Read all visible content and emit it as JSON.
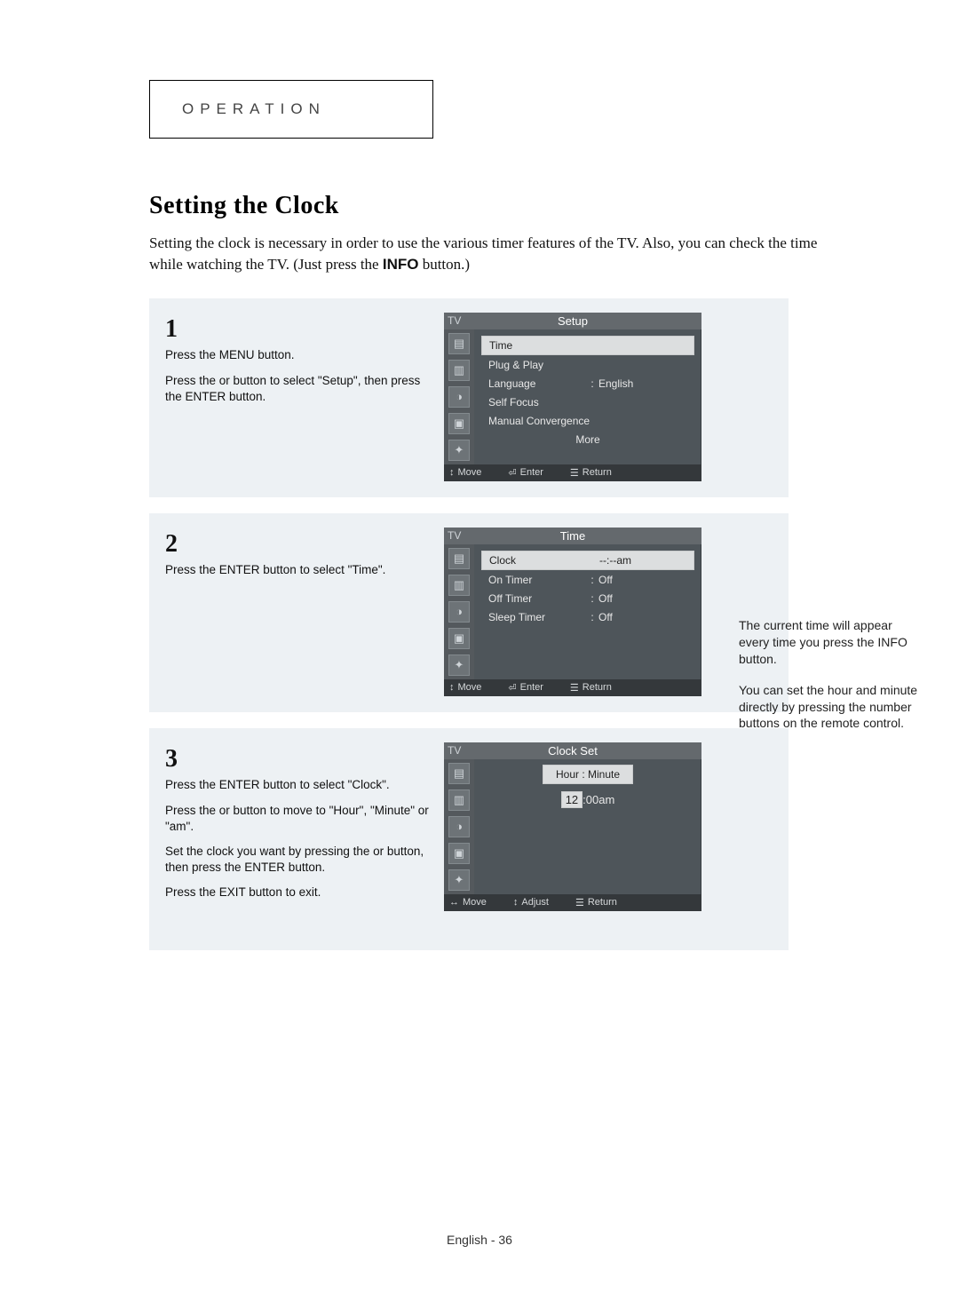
{
  "header": {
    "label": "OPERATION"
  },
  "title": "Setting the Clock",
  "intro": {
    "text_before": "Setting the clock is necessary in order to use the various timer features of the TV. Also, you can check the time while watching the TV. (Just press the ",
    "bold": "INFO",
    "text_after": " button.)"
  },
  "steps": [
    {
      "num": "1",
      "paragraphs": [
        "Press the MENU button.",
        "Press the    or    button to select \"Setup\", then press the ENTER button."
      ],
      "osd": {
        "tv": "TV",
        "title": "Setup",
        "rows": [
          {
            "label": "Time",
            "sep": "",
            "val": "",
            "selected": true
          },
          {
            "label": "Plug & Play",
            "sep": "",
            "val": "",
            "selected": false
          },
          {
            "label": "Language",
            "sep": ":",
            "val": "English",
            "selected": false
          },
          {
            "label": "Self Focus",
            "sep": "",
            "val": "",
            "selected": false
          },
          {
            "label": "Manual Convergence",
            "sep": "",
            "val": "",
            "selected": false
          },
          {
            "label": "More",
            "sep": "",
            "val": "",
            "selected": false,
            "centered": true
          }
        ],
        "footer": {
          "move": "Move",
          "enter": "Enter",
          "return": "Return",
          "move_glyph": "↕",
          "enter_glyph": "⏎",
          "return_glyph": "☰"
        }
      }
    },
    {
      "num": "2",
      "paragraphs": [
        "Press the ENTER button to select \"Time\"."
      ],
      "osd": {
        "tv": "TV",
        "title": "Time",
        "rows": [
          {
            "label": "Clock",
            "sep": "",
            "val": "--:--am",
            "selected": true
          },
          {
            "label": "On Timer",
            "sep": ":",
            "val": "Off",
            "selected": false
          },
          {
            "label": "Off Timer",
            "sep": ":",
            "val": "Off",
            "selected": false
          },
          {
            "label": "Sleep Timer",
            "sep": ":",
            "val": "Off",
            "selected": false
          }
        ],
        "footer": {
          "move": "Move",
          "enter": "Enter",
          "return": "Return",
          "move_glyph": "↕",
          "enter_glyph": "⏎",
          "return_glyph": "☰"
        }
      }
    },
    {
      "num": "3",
      "paragraphs": [
        "Press the ENTER button to select \"Clock\".",
        "Press the    or    button to move to \"Hour\", \"Minute\" or \"am\".",
        "Set the clock you want by pressing the    or    button, then press the ENTER button.",
        "Press the EXIT button to exit."
      ],
      "osd": {
        "tv": "TV",
        "title": "Clock Set",
        "clockset": {
          "hm_label": "Hour : Minute",
          "hour": "12",
          "colon": ":",
          "minute": "00",
          "ampm": "am"
        },
        "footer": {
          "move": "Move",
          "enter": "Adjust",
          "return": "Return",
          "move_glyph": "↔",
          "enter_glyph": "↕",
          "return_glyph": "☰"
        }
      }
    }
  ],
  "side_note": {
    "p1": "The current time will appear every time you press the INFO button.",
    "p2": "You can set the hour and minute directly by pressing the number buttons on the remote control."
  },
  "footer": {
    "text": "English - 36"
  },
  "icons": {
    "sidebar": [
      "▤",
      "▥",
      "◑",
      "▣",
      "✦"
    ]
  }
}
